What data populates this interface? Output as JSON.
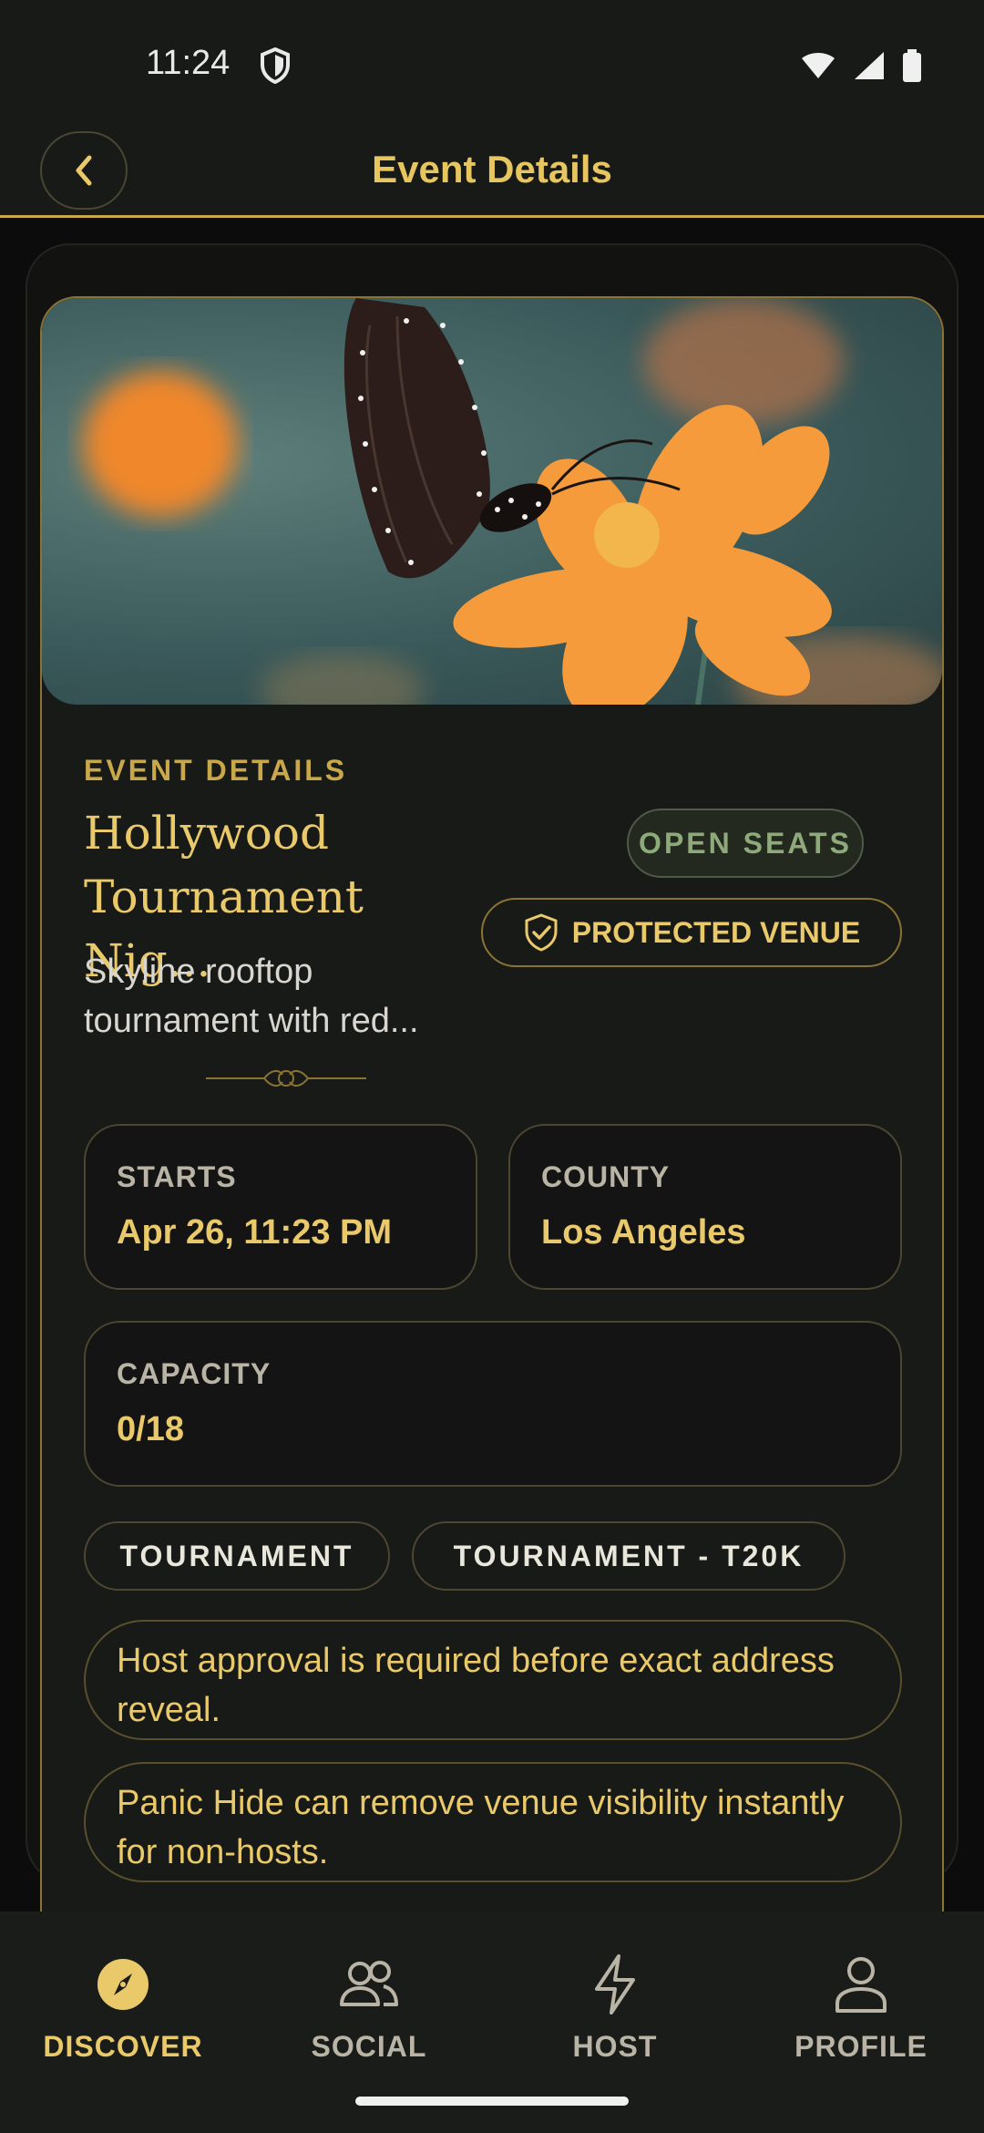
{
  "status_bar": {
    "time": "11:24"
  },
  "app_bar": {
    "title": "Event Details"
  },
  "event": {
    "section_label": "EVENT DETAILS",
    "title": "Hollywood\nTournament Nig...",
    "description": "Skyline rooftop\ntournament with red...",
    "badges": {
      "open_seats": "OPEN SEATS",
      "protected_venue": "PROTECTED VENUE"
    }
  },
  "info": {
    "starts": {
      "label": "STARTS",
      "value": "Apr 26, 11:23 PM"
    },
    "county": {
      "label": "COUNTY",
      "value": "Los Angeles"
    },
    "capacity": {
      "label": "CAPACITY",
      "value": "0/18"
    }
  },
  "chips": [
    "TOURNAMENT",
    "TOURNAMENT - T20K"
  ],
  "notices": [
    "Host approval is required before exact address reveal.",
    "Panic Hide can remove venue visibility instantly for non-hosts."
  ],
  "bottom_nav": [
    {
      "label": "DISCOVER",
      "icon": "compass-icon",
      "active": true
    },
    {
      "label": "SOCIAL",
      "icon": "people-icon",
      "active": false
    },
    {
      "label": "HOST",
      "icon": "lightning-icon",
      "active": false
    },
    {
      "label": "PROFILE",
      "icon": "person-icon",
      "active": false
    }
  ],
  "colors": {
    "accent_gold": "#e9c96a",
    "background": "#181a18",
    "open_green": "#8ea97a"
  }
}
